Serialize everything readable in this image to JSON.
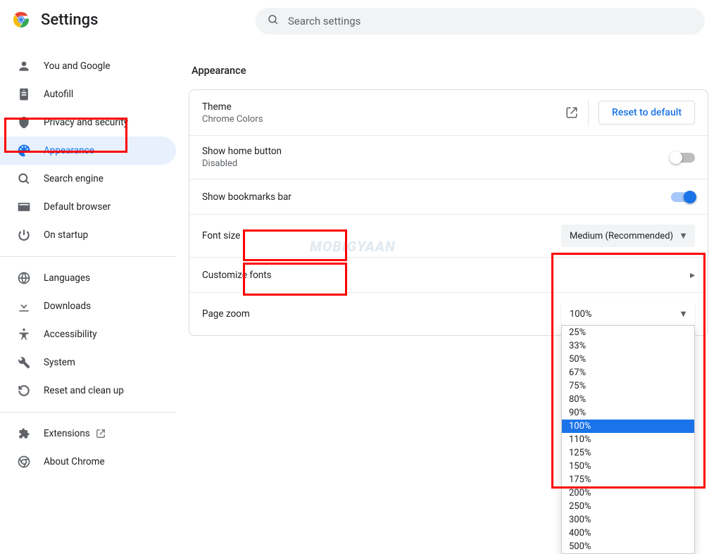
{
  "title": "Settings",
  "search": {
    "placeholder": "Search settings"
  },
  "sidebar": {
    "group1": [
      {
        "label": "You and Google",
        "icon": "person"
      },
      {
        "label": "Autofill",
        "icon": "autofill"
      },
      {
        "label": "Privacy and security",
        "icon": "shield"
      },
      {
        "label": "Appearance",
        "icon": "palette",
        "active": true
      },
      {
        "label": "Search engine",
        "icon": "search"
      },
      {
        "label": "Default browser",
        "icon": "browser"
      },
      {
        "label": "On startup",
        "icon": "power"
      }
    ],
    "group2": [
      {
        "label": "Languages",
        "icon": "globe"
      },
      {
        "label": "Downloads",
        "icon": "download"
      },
      {
        "label": "Accessibility",
        "icon": "access"
      },
      {
        "label": "System",
        "icon": "wrench"
      },
      {
        "label": "Reset and clean up",
        "icon": "reset"
      }
    ],
    "group3": [
      {
        "label": "Extensions",
        "icon": "puzzle",
        "external": true
      },
      {
        "label": "About Chrome",
        "icon": "chrome"
      }
    ]
  },
  "main": {
    "section_title": "Appearance",
    "theme": {
      "label": "Theme",
      "sub": "Chrome Colors",
      "reset": "Reset to default"
    },
    "home": {
      "label": "Show home button",
      "sub": "Disabled",
      "enabled": false
    },
    "bookmarks": {
      "label": "Show bookmarks bar",
      "enabled": true
    },
    "fontsize": {
      "label": "Font size",
      "value": "Medium (Recommended)"
    },
    "customfonts": {
      "label": "Customize fonts"
    },
    "zoom": {
      "label": "Page zoom",
      "value": "100%",
      "options": [
        "25%",
        "33%",
        "50%",
        "67%",
        "75%",
        "80%",
        "90%",
        "100%",
        "110%",
        "125%",
        "150%",
        "175%",
        "200%",
        "250%",
        "300%",
        "400%",
        "500%"
      ],
      "highlighted": "100%"
    }
  },
  "watermark": "MOBIGYAAN"
}
